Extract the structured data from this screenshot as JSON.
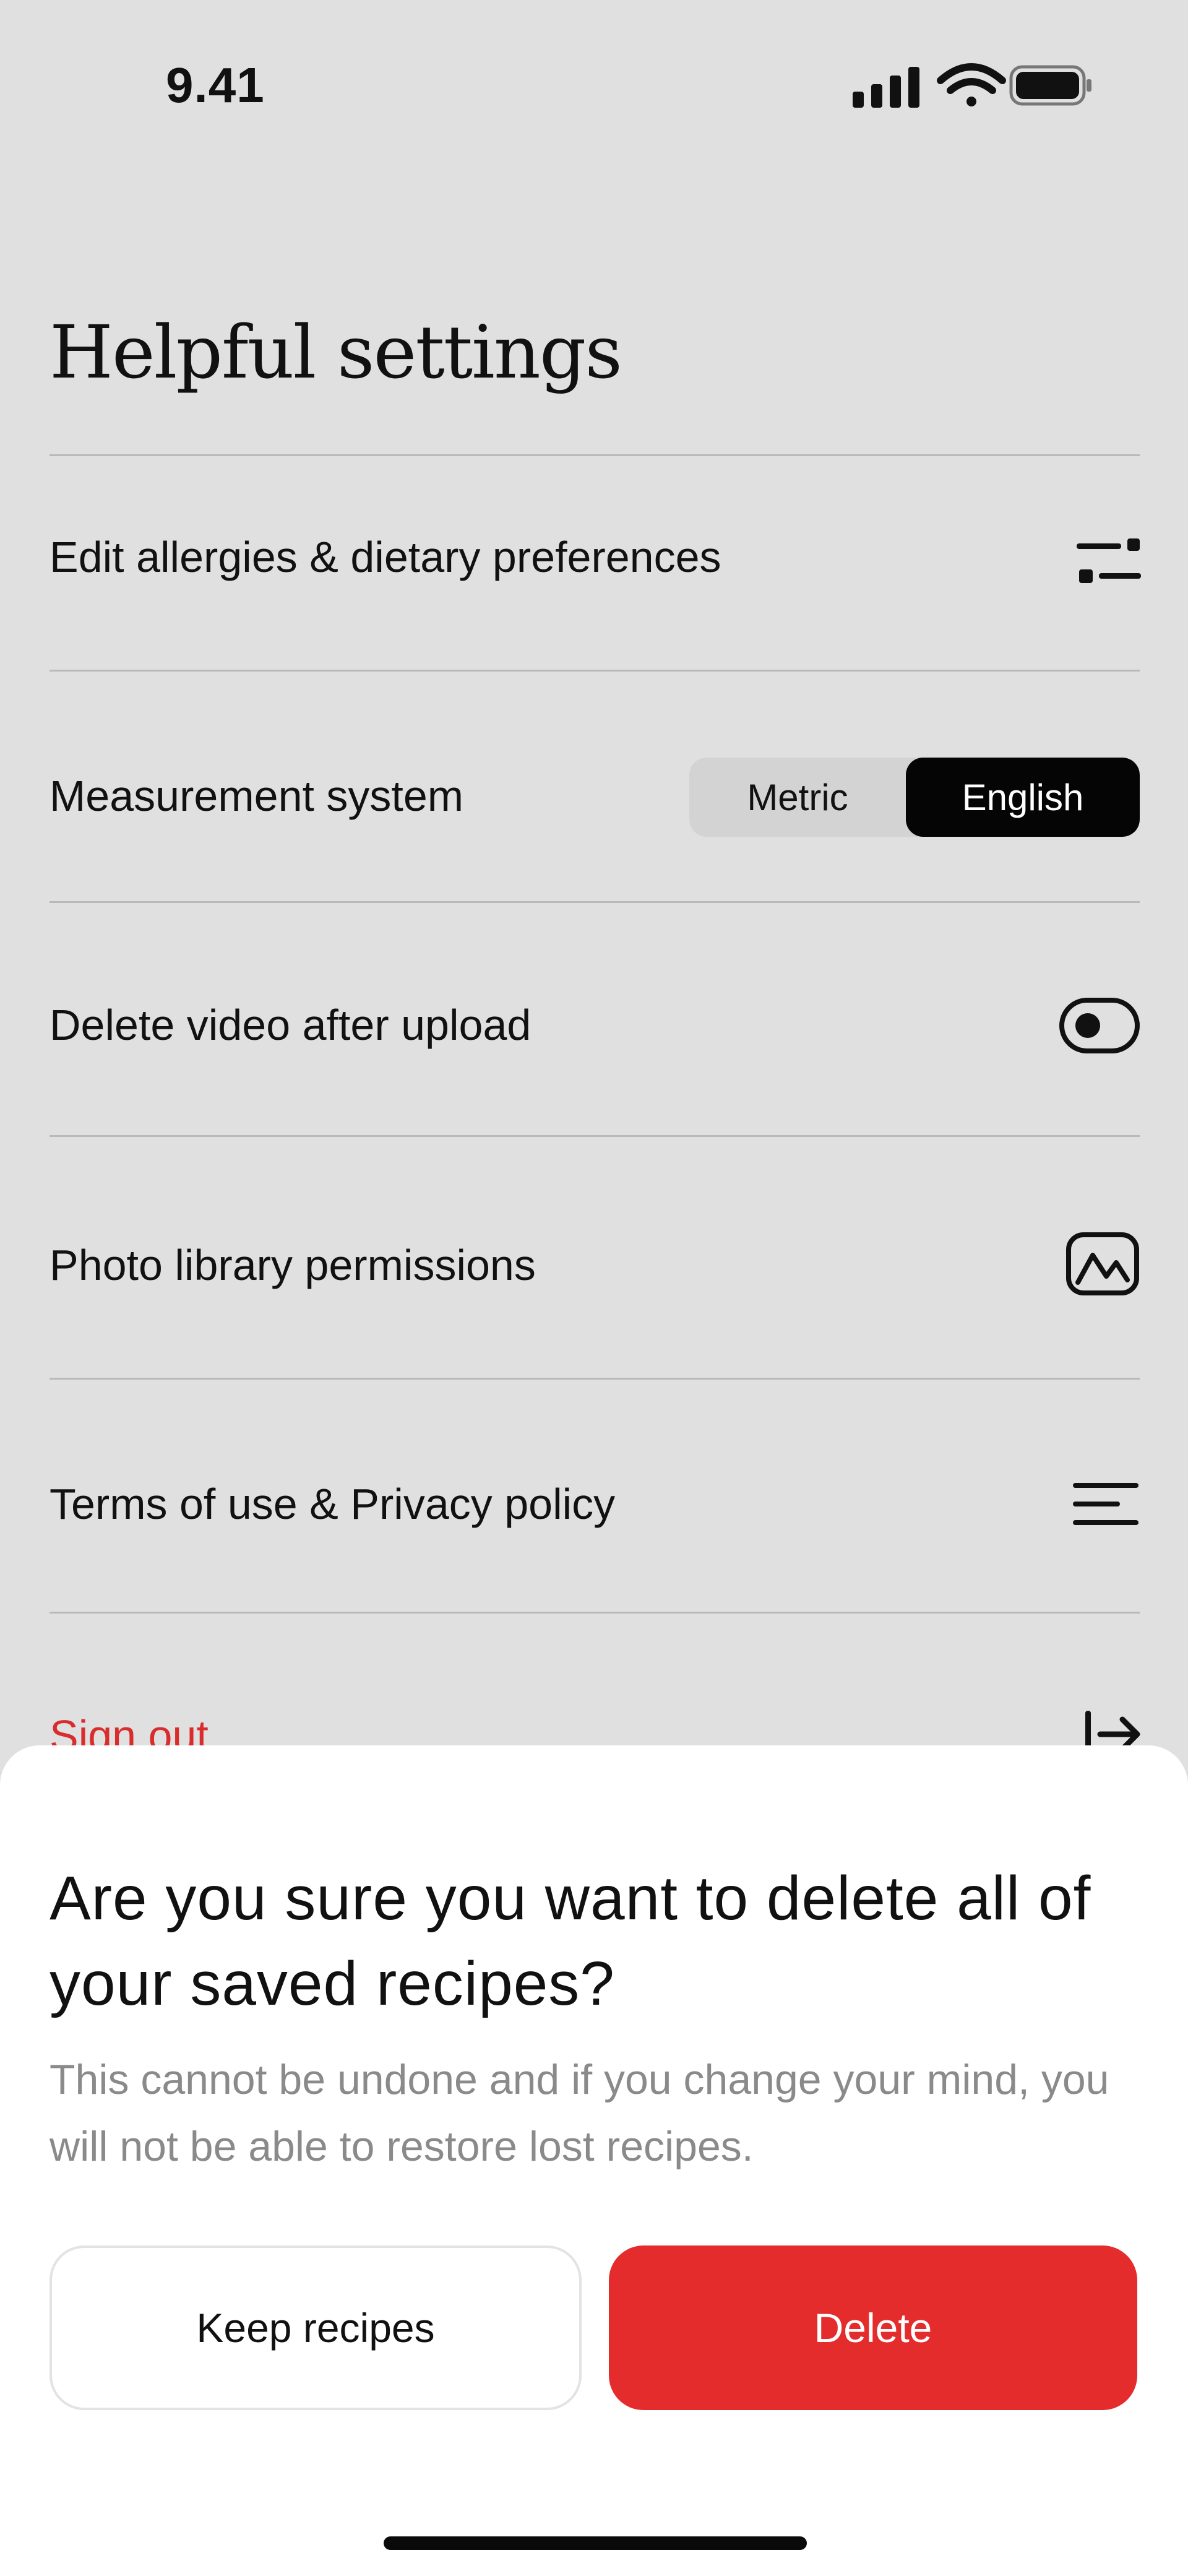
{
  "status_bar": {
    "time": "9.41",
    "icons": [
      "signal-icon",
      "wifi-icon",
      "battery-icon"
    ]
  },
  "page": {
    "title": "Helpful settings"
  },
  "settings": {
    "dietary": {
      "label": "Edit allergies & dietary preferences",
      "icon": "sliders-icon"
    },
    "measurement": {
      "label": "Measurement system",
      "options": [
        "Metric",
        "English"
      ],
      "selected": "English"
    },
    "delete_video": {
      "label": "Delete video after upload",
      "icon": "toggle-off-icon",
      "enabled": false
    },
    "photo_library": {
      "label": "Photo library permissions",
      "icon": "photo-icon"
    },
    "terms": {
      "label": "Terms of use & Privacy policy",
      "icon": "text-lines-icon"
    },
    "sign_out": {
      "label": "Sign out",
      "icon": "sign-out-arrow-icon"
    }
  },
  "dialog": {
    "title": "Are you sure you want to delete all of your saved recipes?",
    "body": "This cannot be undone and if you change your mind, you will not be able to restore lost recipes.",
    "keep_label": "Keep recipes",
    "delete_label": "Delete"
  },
  "colors": {
    "background": "#e0e0e0",
    "sheet": "#ffffff",
    "danger": "#e52c2d",
    "sign_out_text": "#d92d2d",
    "selected_segment": "#050505"
  }
}
